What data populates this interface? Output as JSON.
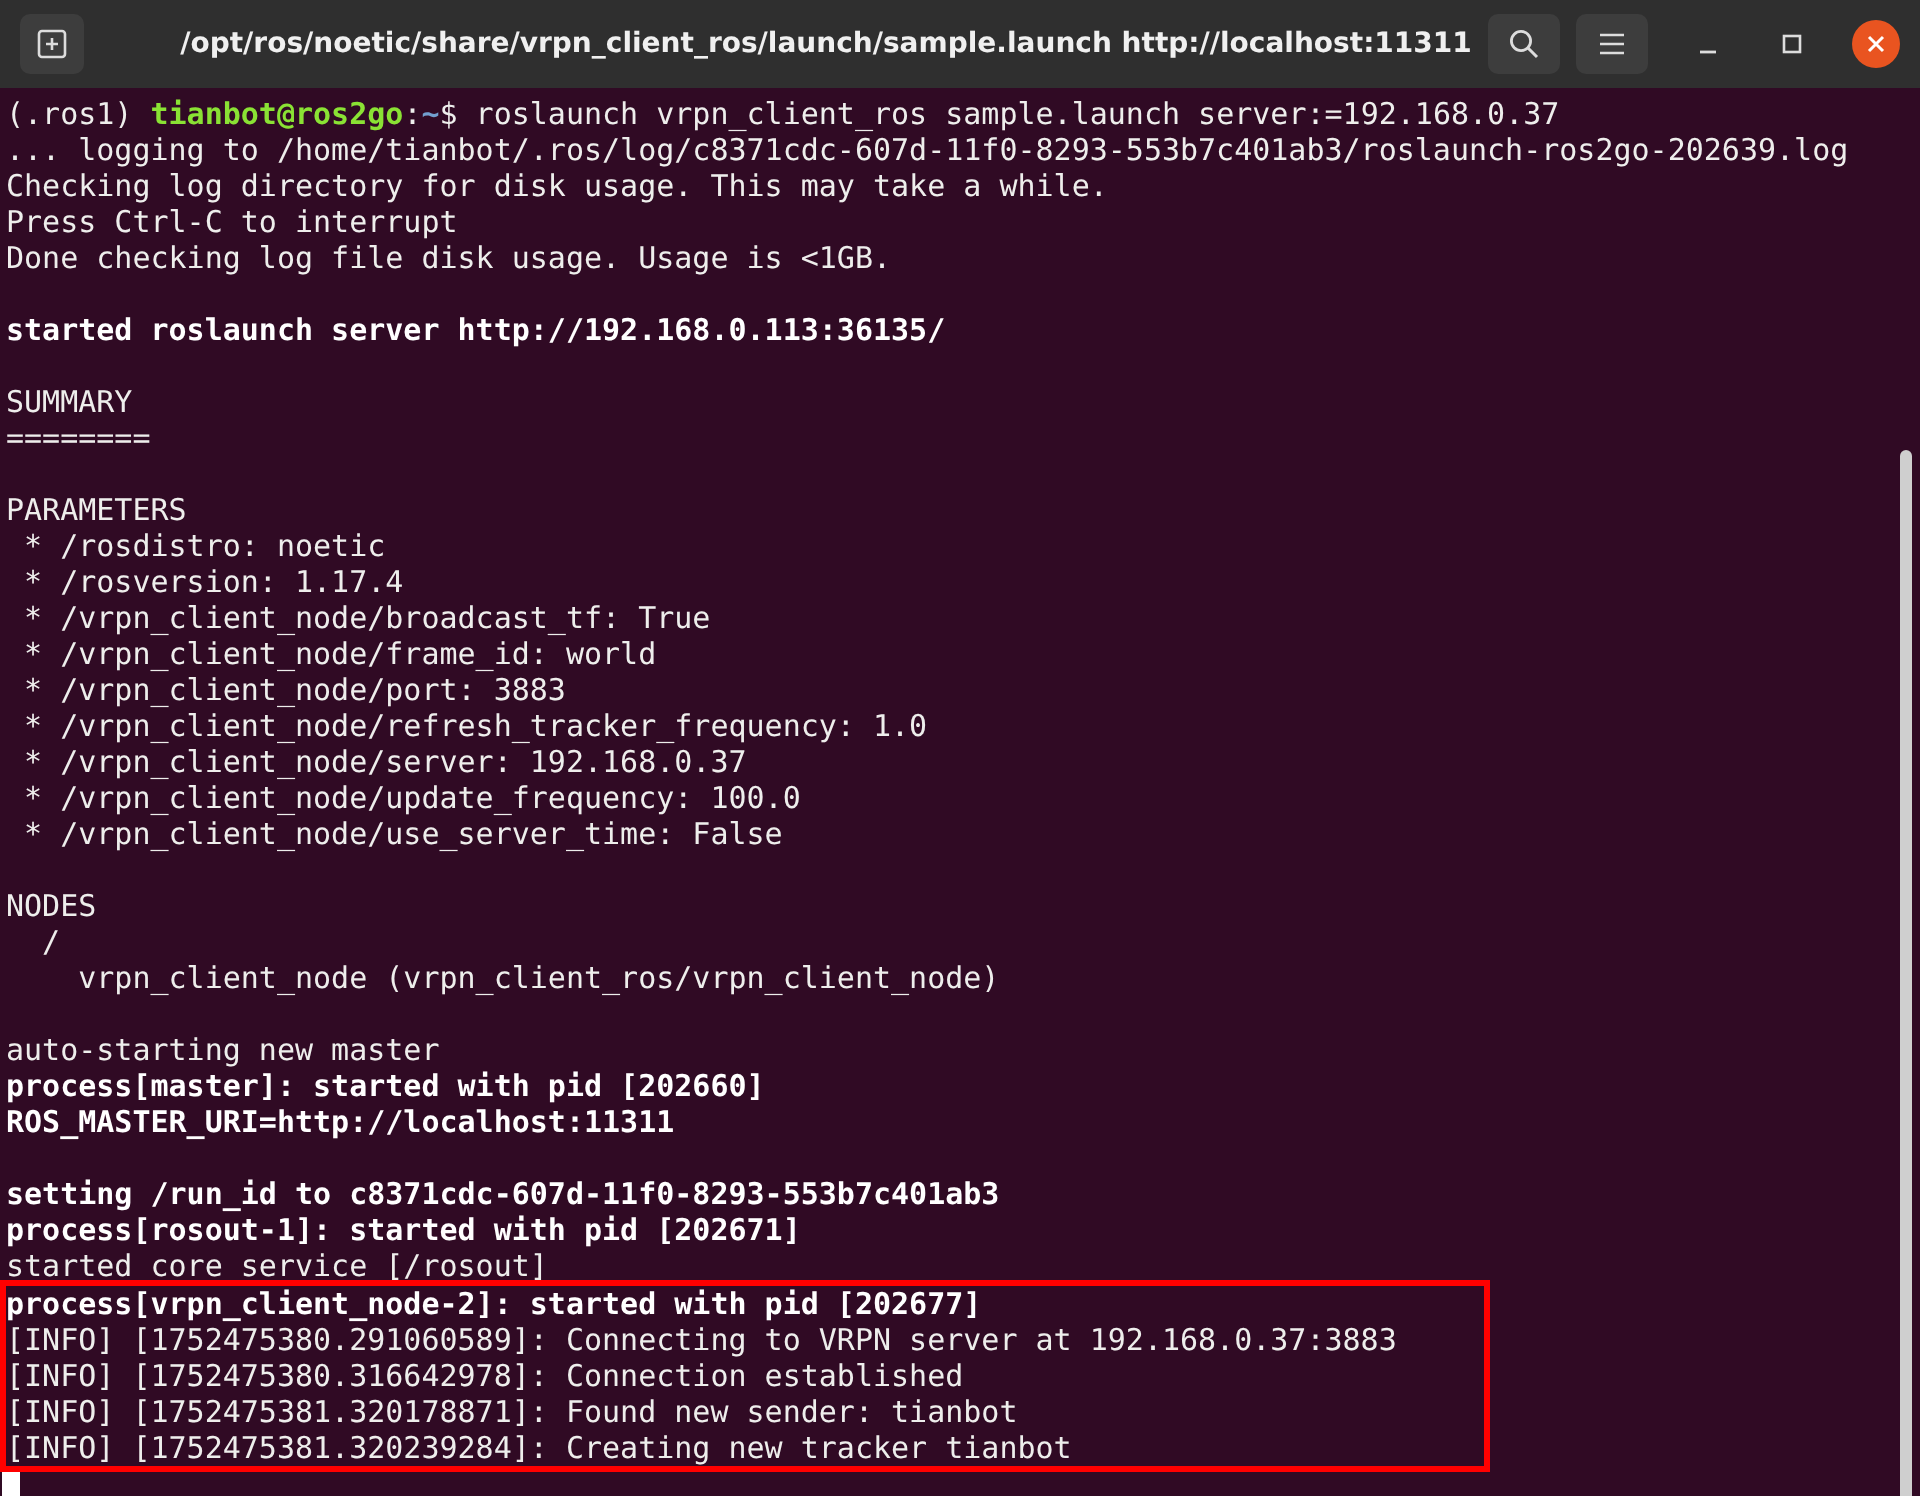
{
  "window": {
    "title": "/opt/ros/noetic/share/vrpn_client_ros/launch/sample.launch http://localhost:11311"
  },
  "terminal": {
    "lines": [
      {
        "kind": "prompt",
        "segments": [
          {
            "kind": "plain",
            "text": "(.ros1) "
          },
          {
            "kind": "user",
            "text": "tianbot@ros2go"
          },
          {
            "kind": "plain",
            "text": ":"
          },
          {
            "kind": "path",
            "text": "~"
          },
          {
            "kind": "plain",
            "text": "$ roslaunch vrpn_client_ros sample.launch server:=192.168.0.37"
          }
        ]
      },
      {
        "kind": "text",
        "text": "... logging to /home/tianbot/.ros/log/c8371cdc-607d-11f0-8293-553b7c401ab3/roslaunch-ros2go-202639.log"
      },
      {
        "kind": "text",
        "text": "Checking log directory for disk usage. This may take a while."
      },
      {
        "kind": "text",
        "text": "Press Ctrl-C to interrupt"
      },
      {
        "kind": "text",
        "text": "Done checking log file disk usage. Usage is <1GB."
      },
      {
        "kind": "blank"
      },
      {
        "kind": "bold",
        "text": "started roslaunch server http://192.168.0.113:36135/"
      },
      {
        "kind": "blank"
      },
      {
        "kind": "text",
        "text": "SUMMARY"
      },
      {
        "kind": "text",
        "text": "========"
      },
      {
        "kind": "blank"
      },
      {
        "kind": "text",
        "text": "PARAMETERS"
      },
      {
        "kind": "text",
        "text": " * /rosdistro: noetic"
      },
      {
        "kind": "text",
        "text": " * /rosversion: 1.17.4"
      },
      {
        "kind": "text",
        "text": " * /vrpn_client_node/broadcast_tf: True"
      },
      {
        "kind": "text",
        "text": " * /vrpn_client_node/frame_id: world"
      },
      {
        "kind": "text",
        "text": " * /vrpn_client_node/port: 3883"
      },
      {
        "kind": "text",
        "text": " * /vrpn_client_node/refresh_tracker_frequency: 1.0"
      },
      {
        "kind": "text",
        "text": " * /vrpn_client_node/server: 192.168.0.37"
      },
      {
        "kind": "text",
        "text": " * /vrpn_client_node/update_frequency: 100.0"
      },
      {
        "kind": "text",
        "text": " * /vrpn_client_node/use_server_time: False"
      },
      {
        "kind": "blank"
      },
      {
        "kind": "text",
        "text": "NODES"
      },
      {
        "kind": "text",
        "text": "  /"
      },
      {
        "kind": "text",
        "text": "    vrpn_client_node (vrpn_client_ros/vrpn_client_node)"
      },
      {
        "kind": "blank"
      },
      {
        "kind": "text",
        "text": "auto-starting new master"
      },
      {
        "kind": "bold",
        "text": "process[master]: started with pid [202660]"
      },
      {
        "kind": "bold",
        "text": "ROS_MASTER_URI=http://localhost:11311"
      },
      {
        "kind": "blank"
      },
      {
        "kind": "bold",
        "text": "setting /run_id to c8371cdc-607d-11f0-8293-553b7c401ab3"
      },
      {
        "kind": "bold",
        "text": "process[rosout-1]: started with pid [202671]"
      },
      {
        "kind": "text",
        "text": "started core service [/rosout]"
      }
    ],
    "highlighted_lines": [
      {
        "kind": "bold",
        "text": "process[vrpn_client_node-2]: started with pid [202677]"
      },
      {
        "kind": "text",
        "text": "[INFO] [1752475380.291060589]: Connecting to VRPN server at 192.168.0.37:3883"
      },
      {
        "kind": "text",
        "text": "[INFO] [1752475380.316642978]: Connection established"
      },
      {
        "kind": "text",
        "text": "[INFO] [1752475381.320178871]: Found new sender: tianbot"
      },
      {
        "kind": "text",
        "text": "[INFO] [1752475381.320239284]: Creating new tracker tianbot"
      }
    ]
  }
}
